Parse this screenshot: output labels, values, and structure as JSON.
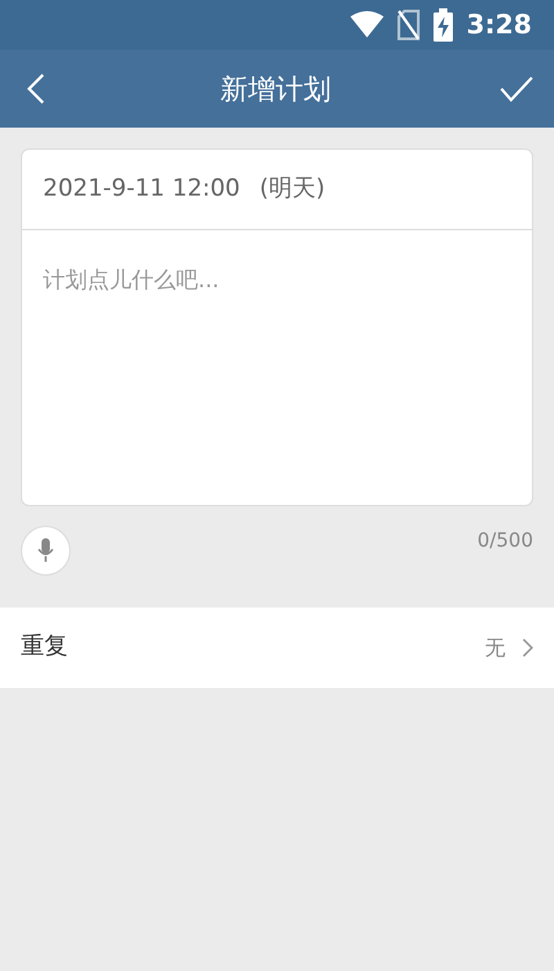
{
  "status_bar": {
    "time": "3:28"
  },
  "header": {
    "title": "新增计划"
  },
  "plan": {
    "date": "2021-9-11 12:00",
    "date_note": "(明天)",
    "placeholder": "计划点儿什么吧...",
    "counter": "0/500"
  },
  "repeat": {
    "label": "重复",
    "value": "无"
  }
}
